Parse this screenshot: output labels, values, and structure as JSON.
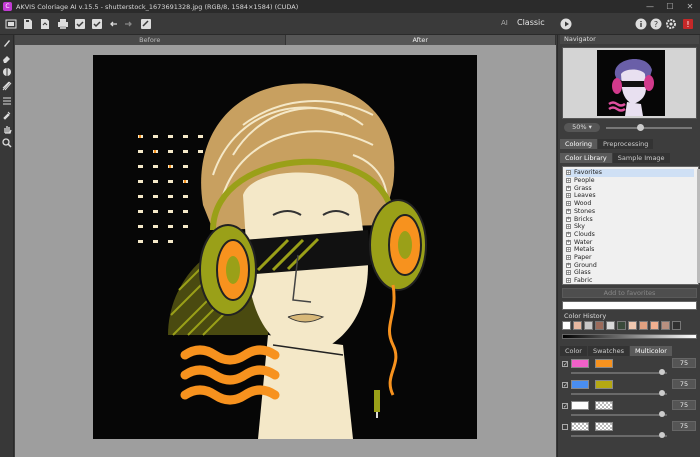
{
  "window": {
    "title": "AKVIS Coloriage AI v.15.5 - shutterstock_1673691328.jpg (RGB/8, 1584×1584) (CUDA)",
    "logo_letter": "C",
    "minimize": "—",
    "maximize": "☐",
    "close": "✕"
  },
  "toolbar": {
    "mode_ai": "AI",
    "mode_classic": "Classic",
    "icons": [
      "open-icon",
      "save-icon",
      "export-icon",
      "print-icon",
      "check-icon",
      "check-all-icon",
      "undo-icon",
      "redo-icon",
      "apply-icon",
      "run-icon",
      "info-icon",
      "help-icon",
      "settings-icon",
      "notifications-icon"
    ]
  },
  "left_tools": [
    "brush-icon",
    "eraser-icon",
    "fill-icon",
    "multicolor-brush-icon",
    "strokes-icon",
    "eyedropper-icon",
    "hand-icon",
    "zoom-icon"
  ],
  "view_tabs": {
    "before": "Before",
    "after": "After"
  },
  "navigator": {
    "title": "Navigator",
    "zoom": "50% ▾"
  },
  "panel_tabs": {
    "coloring": "Coloring",
    "preprocessing": "Preprocessing"
  },
  "library_tabs": {
    "color_library": "Color Library",
    "sample_image": "Sample Image"
  },
  "library": {
    "items": [
      "Favorites",
      "People",
      "Grass",
      "Leaves",
      "Wood",
      "Stones",
      "Bricks",
      "Sky",
      "Clouds",
      "Water",
      "Metals",
      "Paper",
      "Ground",
      "Glass",
      "Fabric"
    ],
    "add_favorites": "Add to favorites"
  },
  "color_history": {
    "title": "Color History",
    "colors": [
      "#ffffff",
      "#e8b8a0",
      "#c8c8c8",
      "#9b6b5b",
      "#d9d9d9",
      "#3a4a3a",
      "#f0c8b0",
      "#e0a080",
      "#f0b090",
      "#b89080",
      "#303030"
    ]
  },
  "color_tabs": {
    "color": "Color",
    "swatches": "Swatches",
    "multicolor": "Multicolor"
  },
  "multicolor": {
    "rows": [
      {
        "checked": "☑",
        "c1": "#f060c8",
        "c2": "#f7921e",
        "value": "75",
        "level": 0.95
      },
      {
        "checked": "☑",
        "c1": "#4a8ef0",
        "c2": "#b5a812",
        "value": "75",
        "level": 0.95
      },
      {
        "checked": "☑",
        "c1": "#ffffff",
        "c2": "checker",
        "value": "75",
        "level": 0.95
      },
      {
        "checked": "",
        "c1": "checker",
        "c2": "checker",
        "value": "75",
        "level": 0.95
      }
    ]
  },
  "art_colors": {
    "background": "#060606",
    "orange": "#f7921e",
    "olive": "#9aa018",
    "cream": "#f4e8c8",
    "hair": "#d8b878"
  }
}
